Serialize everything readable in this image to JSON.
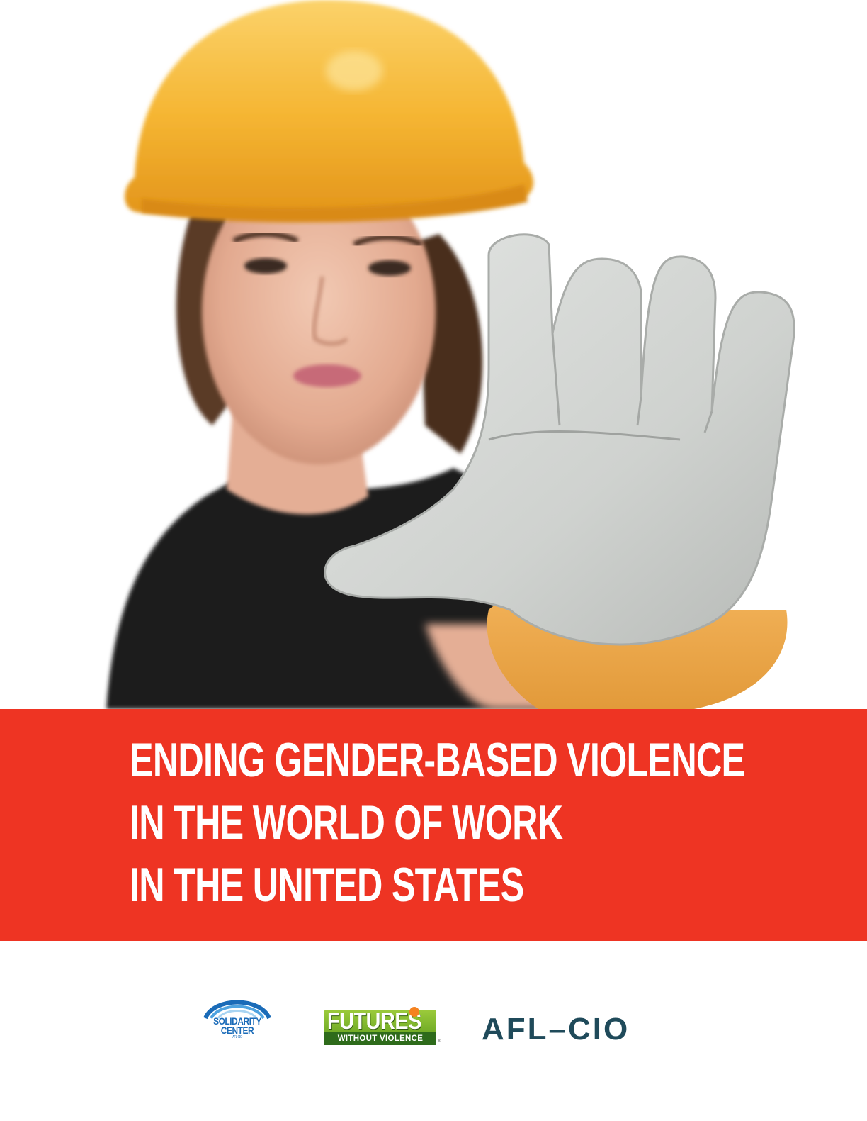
{
  "cover": {
    "title_lines": [
      "ENDING GENDER-BASED VIOLENCE",
      "IN THE WORLD OF WORK",
      "IN THE UNITED STATES"
    ],
    "banner_color": "#ee3423",
    "title_color": "#ffffff"
  },
  "photo": {
    "subject": "woman in yellow hard hat holding up gloved hand in stop gesture",
    "icons": [
      "hard-hat-icon",
      "work-glove-icon"
    ]
  },
  "logos": {
    "solidarity": {
      "line1": "SOLIDARITY",
      "line2": "CENTER",
      "line3": "AFL-CIO",
      "color": "#1a6bb8"
    },
    "futures": {
      "main": "FUTURES",
      "sub": "WITHOUT VIOLENCE",
      "reg": "®",
      "color": "#5a9a1c"
    },
    "aflcio": {
      "text": "AFL–CIO",
      "color": "#1f4a5a"
    }
  }
}
